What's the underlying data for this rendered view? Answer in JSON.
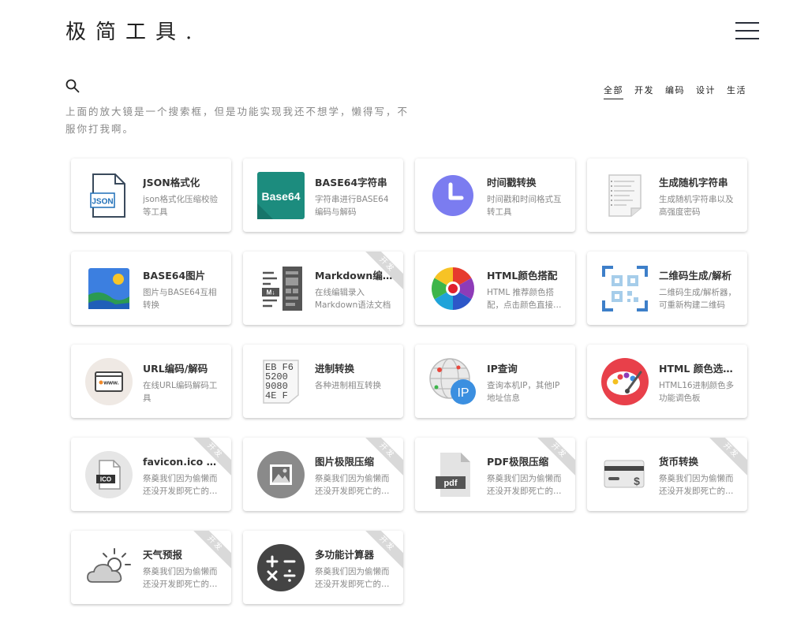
{
  "header": {
    "logo": "极简工具.",
    "menu_icon": "hamburger-menu-icon"
  },
  "search": {
    "icon": "search-icon",
    "description": "上面的放大镜是一个搜索框，但是功能实现我还不想学，懒得写，不服你打我啊。"
  },
  "filters": [
    {
      "label": "全部",
      "active": true
    },
    {
      "label": "开发",
      "active": false
    },
    {
      "label": "编码",
      "active": false
    },
    {
      "label": "设计",
      "active": false
    },
    {
      "label": "生活",
      "active": false
    }
  ],
  "ribbon_label": "开发",
  "tools": [
    {
      "title": "JSON格式化",
      "desc": "json格式化压缩校验等工具",
      "icon": "json-file-icon",
      "ribbon": false
    },
    {
      "title": "BASE64字符串",
      "desc": "字符串进行BASE64编码与解码",
      "icon": "base64-icon",
      "ribbon": false
    },
    {
      "title": "时间戳转换",
      "desc": "时间戳和时间格式互转工具",
      "icon": "clock-icon",
      "ribbon": false
    },
    {
      "title": "生成随机字符串",
      "desc": "生成随机字符串以及高强度密码",
      "icon": "document-icon",
      "ribbon": false
    },
    {
      "title": "BASE64图片",
      "desc": "图片与BASE64互相转换",
      "icon": "image-icon",
      "ribbon": false
    },
    {
      "title": "Markdown编辑器",
      "desc": "在线编辑录入Markdown语法文档",
      "icon": "markdown-icon",
      "ribbon": true
    },
    {
      "title": "HTML颜色搭配",
      "desc": "HTML 推荐颜色搭配，点击颜色直接复制",
      "icon": "color-wheel-icon",
      "ribbon": false
    },
    {
      "title": "二维码生成/解析",
      "desc": "二维码生成/解析器，可重新构建二维码",
      "icon": "qr-code-icon",
      "ribbon": false
    },
    {
      "title": "URL编码/解码",
      "desc": "在线URL编码解码工具",
      "icon": "browser-www-icon",
      "ribbon": false
    },
    {
      "title": "进制转换",
      "desc": "各种进制相互转换",
      "icon": "hex-sheet-icon",
      "ribbon": false
    },
    {
      "title": "IP查询",
      "desc": "查询本机IP，其他IP地址信息",
      "icon": "ip-globe-icon",
      "ribbon": false
    },
    {
      "title": "HTML 颜色选择器",
      "desc": "HTML16进制颜色多功能调色板",
      "icon": "palette-icon",
      "ribbon": false
    },
    {
      "title": "favicon.ico 制作",
      "desc": "祭奠我们因为偷懒而还没开发即死亡的功能",
      "icon": "ico-file-icon",
      "ribbon": true
    },
    {
      "title": "图片极限压缩",
      "desc": "祭奠我们因为偷懒而还没开发即死亡的功能",
      "icon": "picture-icon",
      "ribbon": true
    },
    {
      "title": "PDF极限压缩",
      "desc": "祭奠我们因为偷懒而还没开发即死亡的功能",
      "icon": "pdf-file-icon",
      "ribbon": true
    },
    {
      "title": "货币转换",
      "desc": "祭奠我们因为偷懒而还没开发即死亡的功能",
      "icon": "credit-card-icon",
      "ribbon": true
    },
    {
      "title": "天气预报",
      "desc": "祭奠我们因为偷懒而还没开发即死亡的功能",
      "icon": "weather-cloud-icon",
      "ribbon": true
    },
    {
      "title": "多功能计算器",
      "desc": "祭奠我们因为偷懒而还没开发即死亡的功能",
      "icon": "calculator-icon",
      "ribbon": true
    }
  ]
}
